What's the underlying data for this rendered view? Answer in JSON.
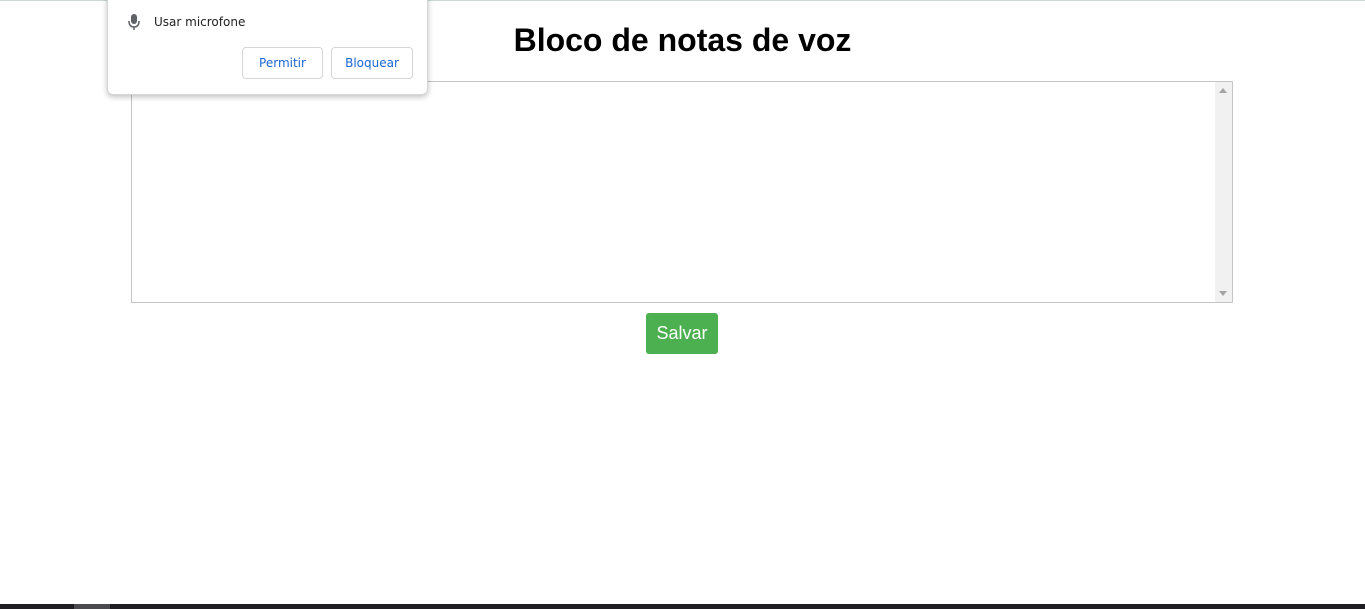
{
  "page": {
    "title": "Bloco de notas de voz",
    "textarea_value": "",
    "save_label": "Salvar"
  },
  "permission_popup": {
    "permission_label": "Usar microfone",
    "allow_label": "Permitir",
    "block_label": "Bloquear",
    "icon": "microphone-icon"
  },
  "colors": {
    "save_button": "#4caf50",
    "popup_button_text": "#1a66d2"
  }
}
